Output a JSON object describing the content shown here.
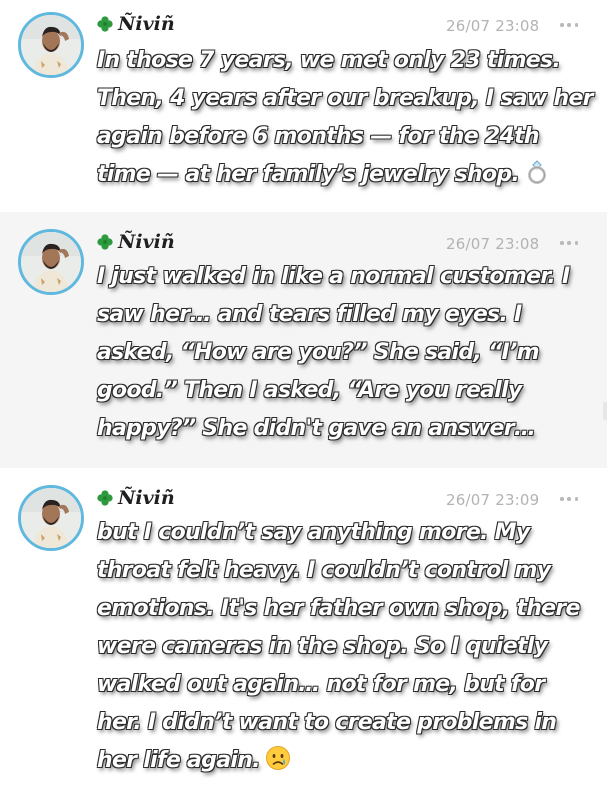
{
  "posts": [
    {
      "author": "Ñiviñ",
      "time": "26/07 23:08",
      "lines": [
        "In those 7 years, we met only 23 times.",
        "Then, 4 years after our breakup, I saw her",
        "again before 6 months — for the 24th",
        "time — at her family’s jewelry shop."
      ],
      "emoji": "ring-icon"
    },
    {
      "author": "Ñiviñ",
      "time": "26/07 23:08",
      "lines": [
        "I just walked in like a normal customer. I",
        "saw her… and tears filled my eyes. I",
        "asked, “How are you?” She said, “I’m",
        "good.” Then I asked, “Are you really",
        "happy?” She didn't gave an answer…"
      ]
    },
    {
      "author": "Ñiviñ",
      "time": "26/07 23:09",
      "lines": [
        "but I couldn’t say anything more. My",
        "throat felt heavy. I couldn’t control my",
        "emotions. It's her father own shop, there",
        "were cameras in the shop. So I quietly",
        "walked out again… not for me, but for",
        "her. I didn’t want to create problems in",
        "her life again."
      ],
      "emoji": "crying-face-icon"
    }
  ],
  "colors": {
    "avatar_ring": "#5fb8de",
    "timestamp": "#b3b3b3",
    "alt_row_bg": "#f5f5f6",
    "clover": "#2e9a3e"
  }
}
